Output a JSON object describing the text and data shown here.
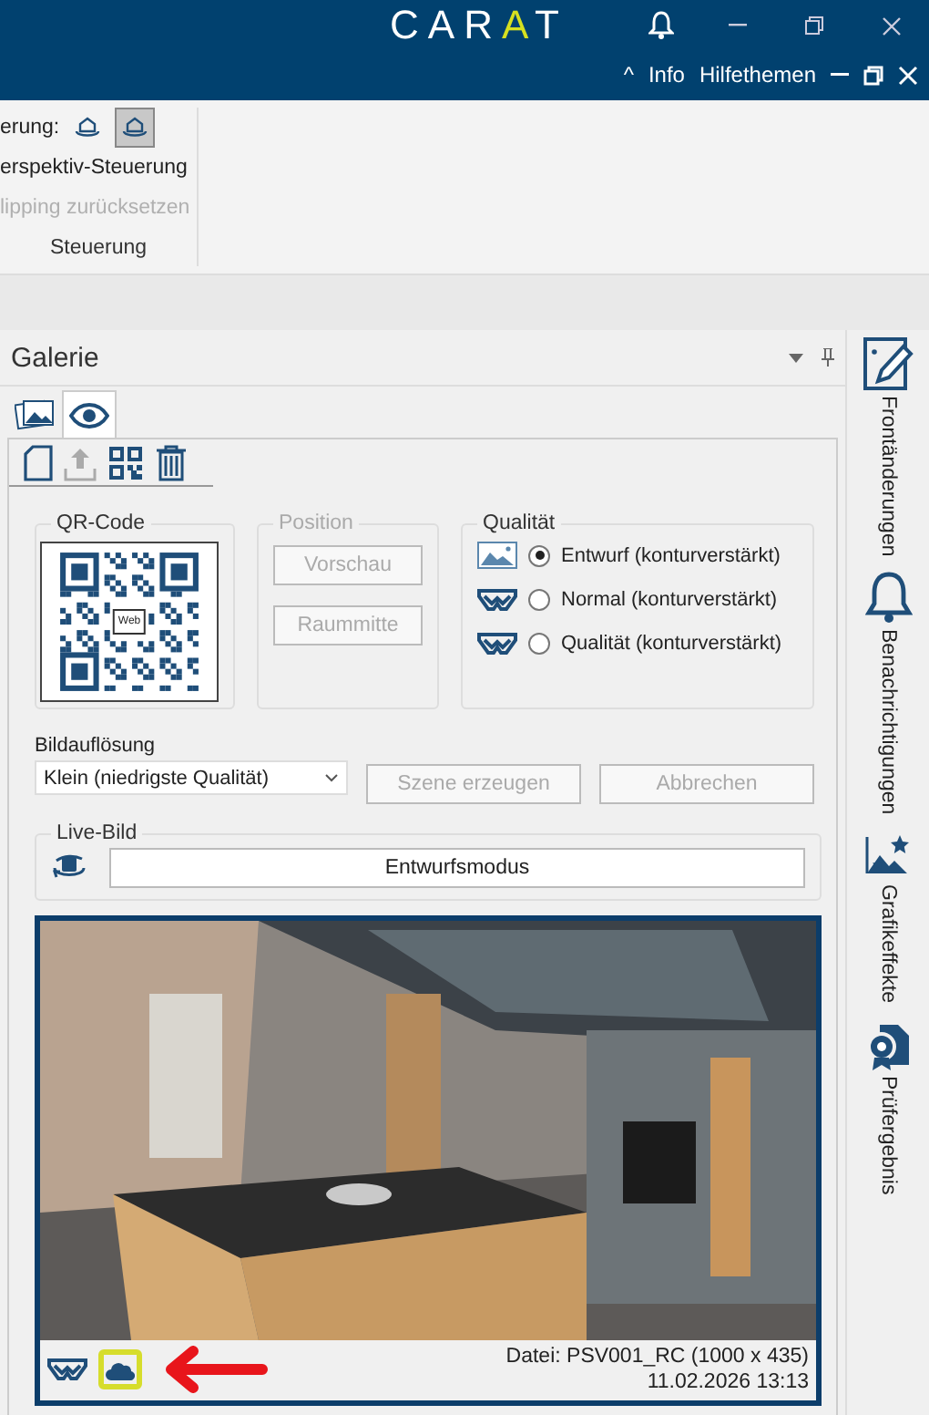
{
  "titlebar": {
    "logo": "CARAT",
    "caret": "^",
    "links": [
      "Info",
      "Hilfethemen"
    ]
  },
  "ribbon": {
    "label": "erung:",
    "view_buttons": [
      {
        "selected": false
      },
      {
        "selected": true
      }
    ],
    "commands": [
      {
        "label": "erspektiv-Steuerung",
        "disabled": false
      },
      {
        "label": "lipping zurücksetzen",
        "disabled": true
      }
    ],
    "group_label": "Steuerung"
  },
  "gallery": {
    "title": "Galerie",
    "tabs": [
      {
        "kind": "images",
        "selected": false
      },
      {
        "kind": "eye",
        "selected": true
      }
    ],
    "qr": {
      "title": "QR-Code",
      "center_label": "Web"
    },
    "position": {
      "title": "Position",
      "disabled": true,
      "buttons": [
        "Vorschau",
        "Raummitte"
      ]
    },
    "quality": {
      "title": "Qualität",
      "options": [
        {
          "kind": "picture",
          "label": "Entwurf (konturverstärkt)",
          "selected": true
        },
        {
          "kind": "glasses",
          "label": "Normal (konturverstärkt)",
          "selected": false
        },
        {
          "kind": "glasses",
          "label": "Qualität (konturverstärkt)",
          "selected": false
        }
      ]
    },
    "resolution": {
      "label": "Bildauflösung",
      "value": "Klein (niedrigste Qualität)"
    },
    "actions": [
      {
        "label": "Szene erzeugen",
        "disabled": true
      },
      {
        "label": "Abbrechen",
        "disabled": true
      }
    ],
    "live": {
      "title": "Live-Bild",
      "button": "Entwurfsmodus"
    },
    "image": {
      "kind": "picture",
      "file": "Datei: PSV001_RC (1000 x 435)",
      "date": "11.02.2026 13:13"
    }
  },
  "side_tabs": [
    {
      "kind": "pencil",
      "label": "Frontänderungen"
    },
    {
      "kind": "bell",
      "label": "Benachrichtigungen"
    },
    {
      "kind": "stars",
      "label": "Grafikeffekte"
    },
    {
      "kind": "badge",
      "label": "Prüfergebnis"
    }
  ]
}
